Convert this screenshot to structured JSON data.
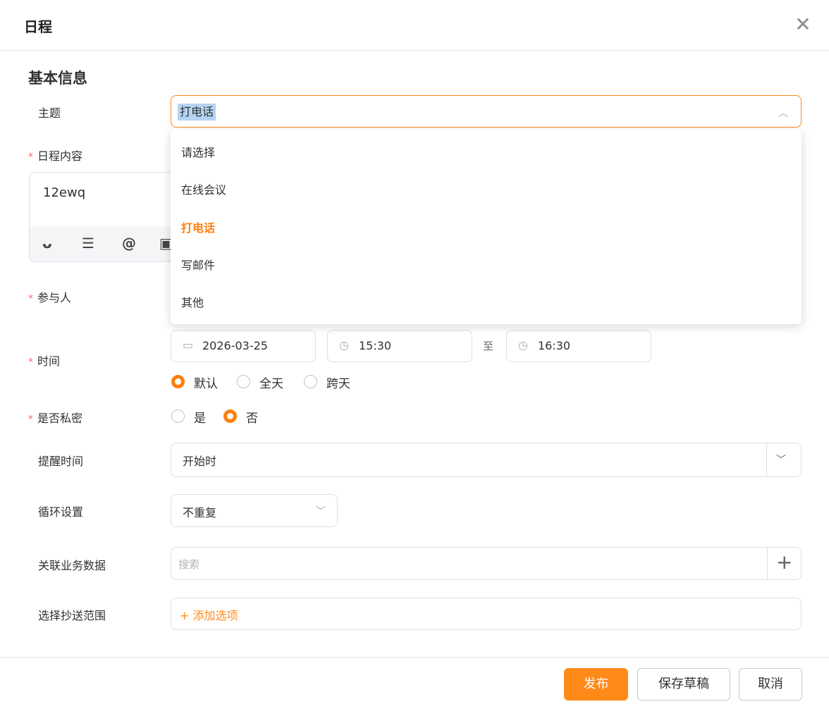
{
  "dialog": {
    "title": "日程",
    "close_icon": "close-icon"
  },
  "section": {
    "title": "基本信息"
  },
  "form": {
    "subject": {
      "label": "主题",
      "value": "打电话",
      "required": false
    },
    "subject_dropdown": {
      "expanded": true,
      "options": [
        "请选择",
        "在线会议",
        "打电话",
        "写邮件",
        "其他"
      ],
      "selected": "打电话"
    },
    "content": {
      "label": "日程内容",
      "required": true,
      "value": "12ewq",
      "toolbar_icons": [
        "emoji-icon",
        "list-icon",
        "mention-icon",
        "image-icon"
      ],
      "toolbar_glyphs": [
        "ᴗ",
        "☰",
        "@",
        "▣"
      ]
    },
    "participants": {
      "label": "参与人",
      "required": true
    },
    "time": {
      "label": "时间",
      "required": true,
      "date": "2026-03-25",
      "start": "15:30",
      "separator": "至",
      "end": "16:30",
      "modes": [
        "默认",
        "全天",
        "跨天"
      ],
      "selected_mode": "默认"
    },
    "private": {
      "label": "是否私密",
      "required": true,
      "options": [
        "是",
        "否"
      ],
      "selected": "否"
    },
    "reminder": {
      "label": "提醒时间",
      "value": "开始时"
    },
    "repeat": {
      "label": "循环设置",
      "value": "不重复"
    },
    "related_data": {
      "label": "关联业务数据",
      "placeholder": "搜索",
      "add_icon": "plus-icon"
    },
    "cc": {
      "label": "选择抄送范围",
      "add_label": "+ 添加选项"
    }
  },
  "footer": {
    "publish_label": "发布",
    "save_draft_label": "保存草稿",
    "cancel_label": "取消"
  },
  "colors": {
    "accent": "#ff8a1a",
    "required": "#f56c6c",
    "selection_highlight": "#b5d4f3"
  }
}
